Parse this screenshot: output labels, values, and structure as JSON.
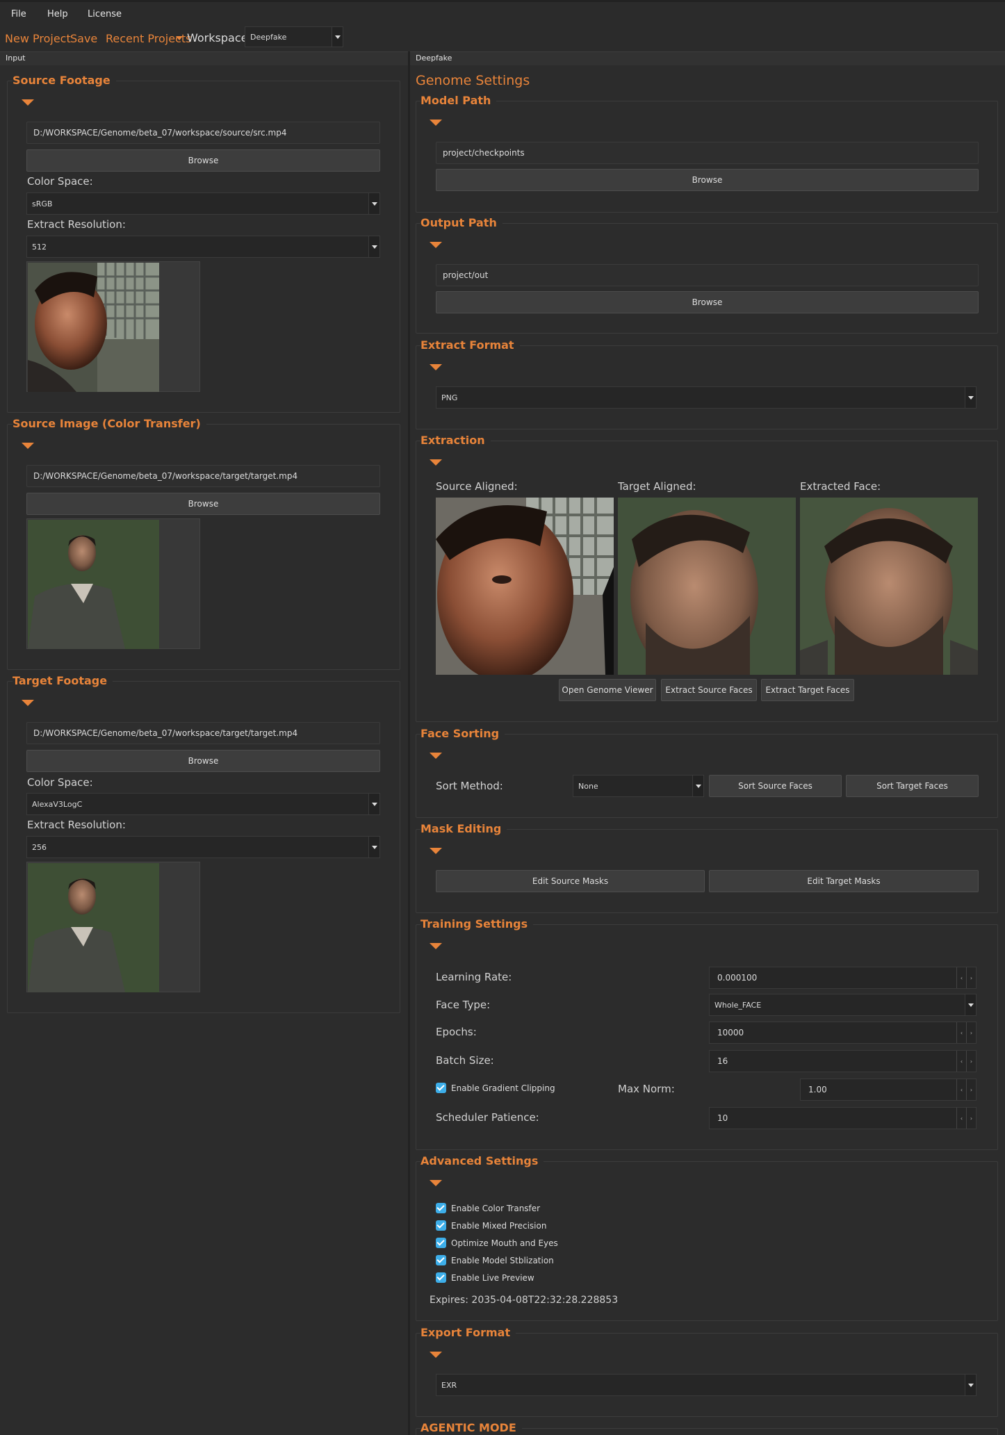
{
  "menu": [
    "File",
    "Help",
    "License"
  ],
  "toolbar": {
    "new_project": "New Project",
    "save": "Save",
    "recent_projects": "Recent Projects",
    "workspace_label": "Workspace:",
    "workspace_value": "Deepfake"
  },
  "docks": {
    "left": "Input",
    "right": "Deepfake"
  },
  "left": {
    "source_footage": {
      "title": "Source Footage",
      "path": "D:/WORKSPACE/Genome/beta_07/workspace/source/src.mp4",
      "browse": "Browse",
      "color_space_label": "Color Space:",
      "color_space": "sRGB",
      "extract_res_label": "Extract Resolution:",
      "extract_res": "512"
    },
    "source_image": {
      "title": "Source Image (Color Transfer)",
      "path": "D:/WORKSPACE/Genome/beta_07/workspace/target/target.mp4",
      "browse": "Browse"
    },
    "target_footage": {
      "title": "Target Footage",
      "path": "D:/WORKSPACE/Genome/beta_07/workspace/target/target.mp4",
      "browse": "Browse",
      "color_space_label": "Color Space:",
      "color_space": "AlexaV3LogC",
      "extract_res_label": "Extract Resolution:",
      "extract_res": "256"
    }
  },
  "right": {
    "header": "Genome Settings",
    "model_path": {
      "title": "Model Path",
      "path": "project/checkpoints",
      "browse": "Browse"
    },
    "output_path": {
      "title": "Output Path",
      "path": "project/out",
      "browse": "Browse"
    },
    "extract_format": {
      "title": "Extract Format",
      "value": "PNG"
    },
    "extraction": {
      "title": "Extraction",
      "source_aligned": "Source Aligned:",
      "target_aligned": "Target Aligned:",
      "extracted_face": "Extracted Face:",
      "open_viewer": "Open Genome Viewer",
      "extract_source": "Extract Source Faces",
      "extract_target": "Extract Target Faces"
    },
    "face_sorting": {
      "title": "Face Sorting",
      "sort_method_label": "Sort Method:",
      "sort_method": "None",
      "sort_source": "Sort Source Faces",
      "sort_target": "Sort Target Faces"
    },
    "mask_editing": {
      "title": "Mask Editing",
      "edit_source": "Edit Source Masks",
      "edit_target": "Edit Target Masks"
    },
    "training": {
      "title": "Training Settings",
      "lr_label": "Learning Rate:",
      "lr": "0.000100",
      "face_type_label": "Face Type:",
      "face_type": "Whole_FACE",
      "epochs_label": "Epochs:",
      "epochs": "10000",
      "batch_label": "Batch Size:",
      "batch": "16",
      "grad_clip": "Enable Gradient Clipping",
      "max_norm_label": "Max Norm:",
      "max_norm": "1.00",
      "patience_label": "Scheduler Patience:",
      "patience": "10"
    },
    "advanced": {
      "title": "Advanced Settings",
      "options": [
        "Enable Color Transfer",
        "Enable Mixed Precision",
        "Optimize Mouth and Eyes",
        "Enable Model Stblization",
        "Enable Live Preview"
      ],
      "expires": "Expires: 2035-04-08T22:32:28.228853"
    },
    "export_format": {
      "title": "Export Format",
      "value": "EXR"
    },
    "agentic": {
      "title": "AGENTIC MODE"
    }
  },
  "colors": {
    "accent": "#e8843a",
    "background": "#2c2c2c",
    "checkbox": "#3daee9"
  }
}
